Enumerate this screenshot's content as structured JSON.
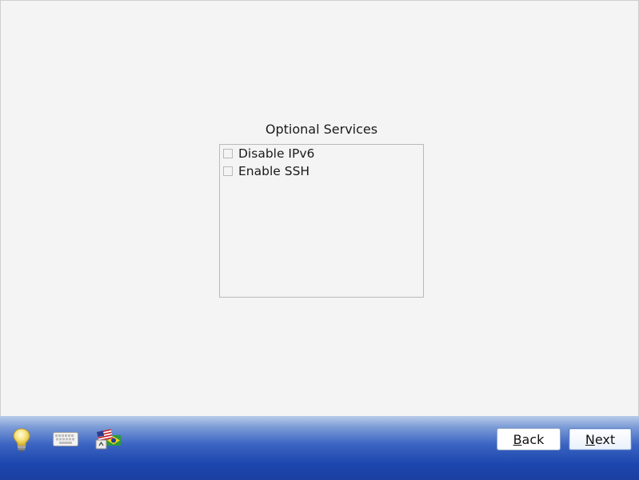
{
  "services": {
    "title": "Optional Services",
    "options": [
      {
        "label": "Disable IPv6",
        "checked": false
      },
      {
        "label": "Enable SSH",
        "checked": false
      }
    ]
  },
  "bottom_bar": {
    "icons": [
      "lightbulb-icon",
      "keyboard-icon",
      "language-flags-icon"
    ],
    "back": {
      "accel": "B",
      "rest": "ack"
    },
    "next": {
      "accel": "N",
      "rest": "ext"
    }
  }
}
